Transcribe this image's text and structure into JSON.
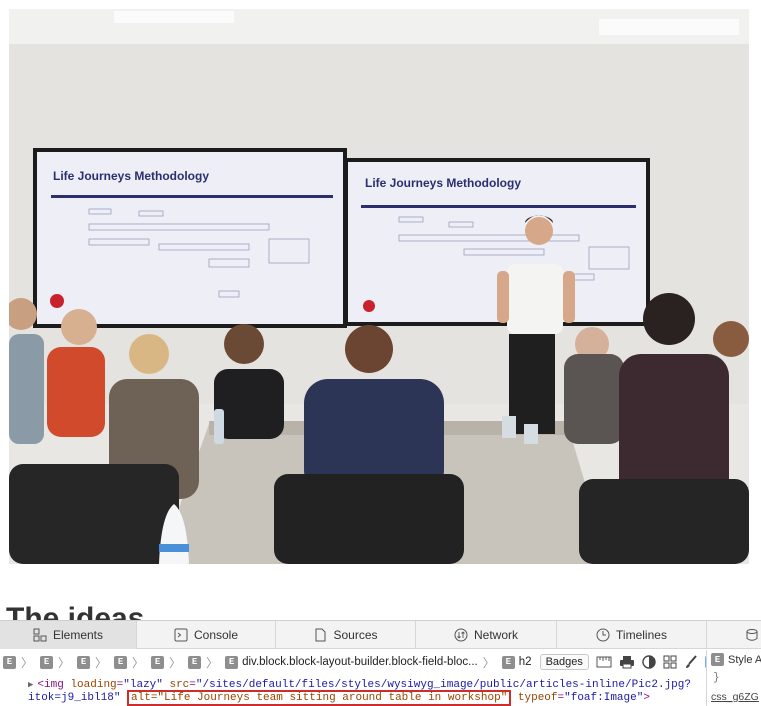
{
  "page": {
    "photo_alt": "Life Journeys team sitting around table in workshop",
    "slide_left_title": "Life Journeys Methodology",
    "slide_right_title": "Life Journeys Methodology",
    "peek_heading": "The ideas"
  },
  "devtools": {
    "tabs": [
      {
        "label": "Elements",
        "icon": "elements-icon"
      },
      {
        "label": "Console",
        "icon": "console-icon"
      },
      {
        "label": "Sources",
        "icon": "sources-icon"
      },
      {
        "label": "Network",
        "icon": "network-icon"
      },
      {
        "label": "Timelines",
        "icon": "timelines-icon"
      }
    ],
    "breadcrumb_selector": "div.block.block-layout-builder.block-field-bloc...",
    "breadcrumb_last": "h2",
    "badge_letter": "E",
    "badges_label": "Badges",
    "code": {
      "tag_open": "<img",
      "attr_loading": "loading",
      "val_loading": "\"lazy\"",
      "attr_src": "src",
      "val_src": "\"/sites/default/files/styles/wysiwyg_image/public/articles-inline/Pic2.jpg?",
      "val_src_cont": "itok=j9_ibl18\"",
      "alt_text": "alt=\"Life Journeys team sitting around table in workshop\"",
      "attr_typeof": "typeof",
      "val_typeof": "\"foaf:Image\"",
      "tag_close": ">"
    },
    "side": {
      "header": "Style A",
      "brace": "}",
      "css_link": "css_g6ZG"
    }
  }
}
